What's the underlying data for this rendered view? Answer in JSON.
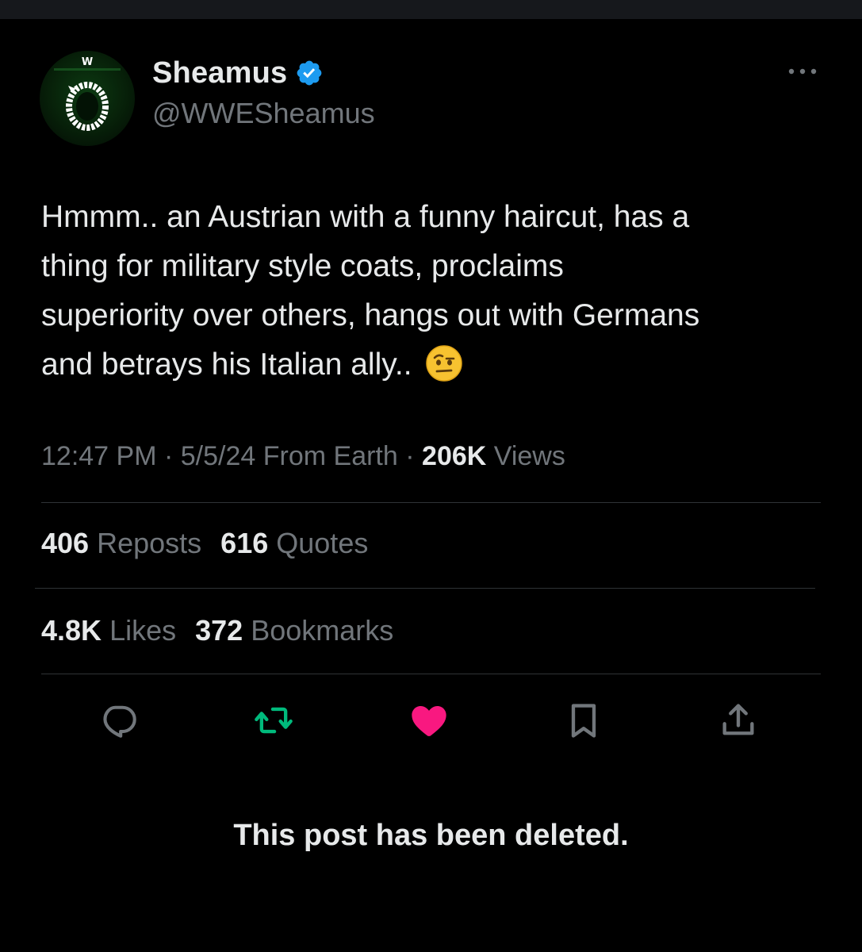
{
  "author": {
    "display_name": "Sheamus",
    "handle": "@WWESheamus",
    "verified": true,
    "avatar_badge_text": "W"
  },
  "tweet": {
    "text": "Hmmm.. an Austrian with a funny haircut, has a\nthing for military style coats, proclaims\nsuperiority over others, hangs out with Germans\nand betrays his Italian ally.. ",
    "emoji": "face-with-raised-eyebrow",
    "time": "12:47 PM",
    "date": "5/5/24",
    "source": "From Earth",
    "views_count": "206K",
    "views_label": "Views"
  },
  "stats": {
    "reposts_count": "406",
    "reposts_label": "Reposts",
    "quotes_count": "616",
    "quotes_label": "Quotes",
    "likes_count": "4.8K",
    "likes_label": "Likes",
    "bookmarks_count": "372",
    "bookmarks_label": "Bookmarks"
  },
  "actions": [
    "reply",
    "repost",
    "like",
    "bookmark",
    "share"
  ],
  "colors": {
    "background": "#000000",
    "text_primary": "#e7e9ea",
    "text_secondary": "#71767b",
    "divider": "#2f3336",
    "verified": "#1d9bf0",
    "repost_active": "#00ba7c",
    "like_active": "#f91880",
    "icon_default": "#71767b"
  },
  "notice": "This post has been deleted."
}
